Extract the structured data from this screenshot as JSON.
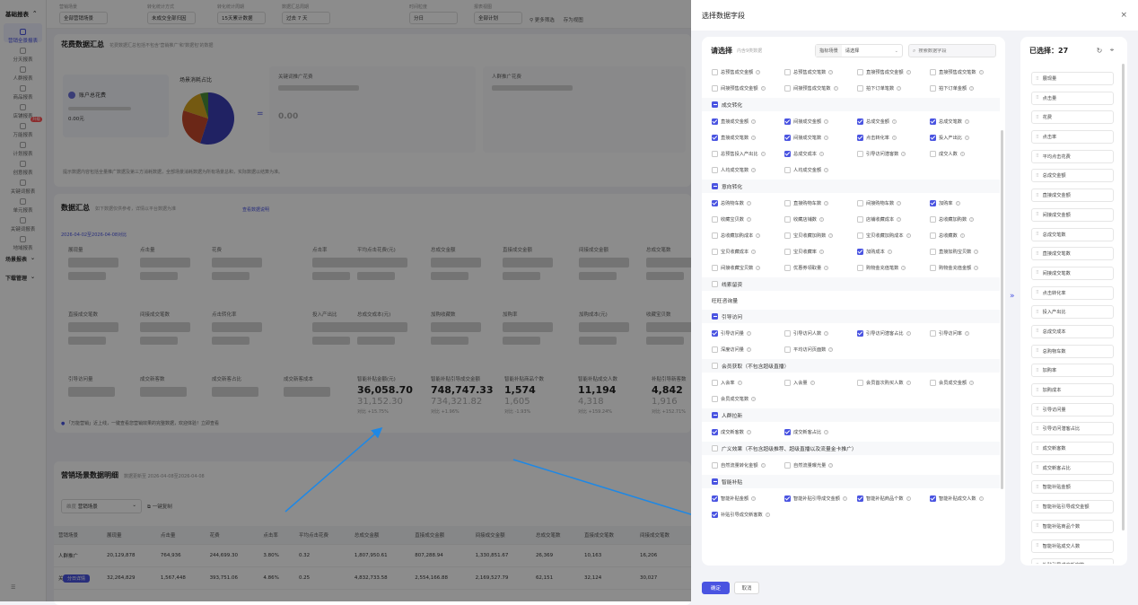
{
  "sidebar": {
    "header": "基础报表",
    "items": [
      {
        "label": "营销全景报表",
        "active": true
      },
      {
        "label": "分天报表"
      },
      {
        "label": "人群报表"
      },
      {
        "label": "商品报表"
      },
      {
        "label": "店铺报表"
      },
      {
        "label": "万能报表",
        "badge": "升级"
      },
      {
        "label": "计划报表"
      },
      {
        "label": "创意报表"
      },
      {
        "label": "关键词报表"
      },
      {
        "label": "单元报表"
      },
      {
        "label": "关键词报表"
      },
      {
        "label": "地域报表"
      }
    ],
    "groups": [
      "场景报表",
      "下载管理"
    ]
  },
  "filters": [
    {
      "label": "营销场景",
      "value": "全部营销场景"
    },
    {
      "label": "转化统计方式",
      "value": "未成交全部归因"
    },
    {
      "label": "转化统计周期",
      "value": "15天累计数据"
    },
    {
      "label": "数据汇总周期",
      "value": "过去 7 天"
    },
    {
      "label": "时间粒度",
      "value": "分日"
    },
    {
      "label": "报表视图",
      "value": "全部计划"
    }
  ],
  "filter_actions": [
    "更多筛选",
    "存为视图"
  ],
  "spend_card": {
    "title": "花费数据汇总",
    "subtitle": "花费数据汇总包括不包含'营销推广'和'数据包'的数据",
    "account_label": "账户总花费",
    "account_value": "0.00元",
    "pie_title": "场景消耗占比",
    "pie_slices": [
      {
        "value": 55,
        "color": "#3b3fb5"
      },
      {
        "value": 25,
        "color": "#c4472a"
      },
      {
        "value": 15,
        "color": "#d4a21f"
      },
      {
        "value": 5,
        "color": "#4c8f3a"
      }
    ],
    "box1_title": "关键词推广花费",
    "box2_title": "人群推广花费",
    "side_value": "0.00",
    "notice": "提示数据内容包括全量推广数据及第三方消耗数据，全部场景消耗数据为所有场景总和，实际数据以结算为准。"
  },
  "data_summary": {
    "title": "数据汇总",
    "subtitle": "如下数据仅供参考，详情以平台数据为准",
    "link": "查看数据说明",
    "date_range": "2026-04-02至2026-04-08对比",
    "row1_labels": [
      "展现量",
      "点击量",
      "花费",
      "点击率",
      "平均点击花费(元)",
      "总成交金额",
      "直接成交金额",
      "间接成交金额",
      "总成交笔数"
    ],
    "row2_labels": [
      "直接成交笔数",
      "间接成交笔数",
      "点击转化率",
      "投入产出比",
      "总成交成本(元)",
      "加购收藏数",
      "加购率",
      "加购成本(元)",
      "收藏宝贝数"
    ],
    "row3_labels": [
      "引导访问量",
      "成交新客数",
      "成交新客占比",
      "成交新客成本"
    ],
    "metrics": [
      {
        "label": "智能补贴金额(元)",
        "current": "36,058.70",
        "previous": "31,152.30",
        "change": "对比 +15.75%",
        "dir": "up"
      },
      {
        "label": "智能补贴引导成交金额",
        "current": "748,747.33",
        "previous": "734,321.82",
        "change": "对比 +1.96%",
        "dir": "up"
      },
      {
        "label": "智能补贴商品个数",
        "current": "1,574",
        "previous": "1,605",
        "change": "对比 -1.93%",
        "dir": "down"
      },
      {
        "label": "智能补贴成交人数",
        "current": "11,194",
        "previous": "4,318",
        "change": "对比 +159.24%",
        "dir": "up"
      },
      {
        "label": "补贴引导新客数",
        "current": "4,842",
        "previous": "1,916",
        "change": "对比 +152.71%",
        "dir": "up"
      }
    ],
    "tip": "「万能营销」近上线，一键查看您营销效果的完整数据，欢迎体验！立即查看"
  },
  "detail": {
    "title": "营销场景数据明细",
    "subtitle": "数据更新至 2026-04-08至2026-04-08",
    "select_label": "维度",
    "select_value": "营销场景",
    "action": "一键复制",
    "columns": [
      "营销场景",
      "展现量",
      "点击量",
      "花费",
      "点击率",
      "平均点击花费",
      "总成交金额",
      "直接成交金额",
      "间接成交金额",
      "总成交笔数",
      "直接成交笔数",
      "间接成交笔数"
    ],
    "rows": [
      [
        "人群推广",
        "20,129,878",
        "764,936",
        "244,699.30",
        "3.80%",
        "0.32",
        "1,807,950.61",
        "807,288.94",
        "1,330,851.67",
        "26,369",
        "10,163",
        "16,206"
      ],
      [
        "关键词推广",
        "32,264,829",
        "1,567,448",
        "393,751.06",
        "4.86%",
        "0.25",
        "4,832,733.58",
        "2,554,166.88",
        "2,169,527.79",
        "62,151",
        "32,124",
        "30,027"
      ]
    ],
    "tag": "分日详情"
  },
  "modal": {
    "title": "选择数据字段",
    "left_title": "请选择",
    "left_sub": "内含9类数据",
    "scope_label": "指标场景",
    "scope_value": "请选择",
    "search_placeholder": "搜索数据字段",
    "top_fields": [
      {
        "label": "总预售成交金额",
        "checked": false
      },
      {
        "label": "总预售成交笔数",
        "checked": false
      },
      {
        "label": "直接预售成交金额",
        "checked": false
      },
      {
        "label": "直接预售成交笔数",
        "checked": false
      },
      {
        "label": "间接预售成交金额",
        "checked": false
      },
      {
        "label": "间接预售成交笔数",
        "checked": false
      },
      {
        "label": "拍下订单笔数",
        "checked": false
      },
      {
        "label": "拍下订单金额",
        "checked": false
      }
    ],
    "groups": [
      {
        "name": "成交转化",
        "state": "part",
        "fields": [
          {
            "label": "直接成交金额",
            "checked": true
          },
          {
            "label": "间接成交金额",
            "checked": true
          },
          {
            "label": "总成交金额",
            "checked": true
          },
          {
            "label": "总成交笔数",
            "checked": true
          },
          {
            "label": "直接成交笔数",
            "checked": true
          },
          {
            "label": "间接成交笔数",
            "checked": true
          },
          {
            "label": "点击转化率",
            "checked": true
          },
          {
            "label": "投入产出比",
            "checked": true
          },
          {
            "label": "总预售投入产出比",
            "checked": false
          },
          {
            "label": "总成交成本",
            "checked": true
          },
          {
            "label": "引导访问潜客数",
            "checked": false
          },
          {
            "label": "成交人数",
            "checked": false
          },
          {
            "label": "人均成交笔数",
            "checked": false
          },
          {
            "label": "人均成交金额",
            "checked": false
          }
        ]
      },
      {
        "name": "意向转化",
        "state": "part",
        "fields": [
          {
            "label": "总购物车数",
            "checked": true
          },
          {
            "label": "直接购物车数",
            "checked": false
          },
          {
            "label": "间接购物车数",
            "checked": false
          },
          {
            "label": "加购率",
            "checked": true
          },
          {
            "label": "收藏宝贝数",
            "checked": false
          },
          {
            "label": "收藏店铺数",
            "checked": false
          },
          {
            "label": "店铺收藏成本",
            "checked": false
          },
          {
            "label": "总收藏加购数",
            "checked": false
          },
          {
            "label": "总收藏加购成本",
            "checked": false
          },
          {
            "label": "宝贝收藏加购数",
            "checked": false
          },
          {
            "label": "宝贝收藏加购成本",
            "checked": false
          },
          {
            "label": "总收藏数",
            "checked": false
          },
          {
            "label": "宝贝收藏成本",
            "checked": false
          },
          {
            "label": "宝贝收藏率",
            "checked": false
          },
          {
            "label": "加购成本",
            "checked": true
          },
          {
            "label": "直接加购宝贝数",
            "checked": false
          },
          {
            "label": "间接收藏宝贝数",
            "checked": false
          },
          {
            "label": "优惠券领取量",
            "checked": false
          },
          {
            "label": "购物金充值笔数",
            "checked": false
          },
          {
            "label": "购物金充值金额",
            "checked": false
          }
        ]
      },
      {
        "name": "线索留资",
        "state": "none",
        "fields": []
      },
      {
        "name": "旺旺咨询量",
        "state": "none",
        "plain": true,
        "fields": []
      },
      {
        "name": "引导访问",
        "state": "part",
        "fields": [
          {
            "label": "引导访问量",
            "checked": true
          },
          {
            "label": "引导访问人数",
            "checked": false
          },
          {
            "label": "引导访问潜客占比",
            "checked": true
          },
          {
            "label": "引导访问率",
            "checked": false
          },
          {
            "label": "深度访问量",
            "checked": false
          },
          {
            "label": "平均访问页面数",
            "checked": false
          }
        ]
      },
      {
        "name": "会员获取（不包含超级直播）",
        "state": "none",
        "fields": [
          {
            "label": "入会率",
            "checked": false
          },
          {
            "label": "入会量",
            "checked": false
          },
          {
            "label": "会员首次购买人数",
            "checked": false
          },
          {
            "label": "会员成交金额",
            "checked": false
          },
          {
            "label": "会员成交笔数",
            "checked": false
          }
        ]
      },
      {
        "name": "人群拉新",
        "state": "part",
        "fields": [
          {
            "label": "成交新客数",
            "checked": true
          },
          {
            "label": "成交新客占比",
            "checked": true
          }
        ]
      },
      {
        "name": "广义效果（不包含超级推荐、超级直播以及流量金卡推广）",
        "state": "none",
        "fields": [
          {
            "label": "自然流量转化金额",
            "checked": false
          },
          {
            "label": "自然流量曝光量",
            "checked": false
          }
        ]
      },
      {
        "name": "智能补贴",
        "state": "part",
        "fields": [
          {
            "label": "智能补贴金额",
            "checked": true
          },
          {
            "label": "智能补贴引导成交金额",
            "checked": true
          },
          {
            "label": "智能补贴商品个数",
            "checked": true
          },
          {
            "label": "智能补贴成交人数",
            "checked": true
          },
          {
            "label": "补贴引导成交新客数",
            "checked": true
          }
        ]
      }
    ],
    "right_title": "已选择：27",
    "selected": [
      "展现量",
      "点击量",
      "花费",
      "点击率",
      "平均点击花费",
      "总成交金额",
      "直接成交金额",
      "间接成交金额",
      "总成交笔数",
      "直接成交笔数",
      "间接成交笔数",
      "点击转化率",
      "投入产出比",
      "总成交成本",
      "总购物车数",
      "加购率",
      "加购成本",
      "引导访问量",
      "引导访问潜客占比",
      "成交新客数",
      "成交新客占比",
      "智能补贴金额",
      "智能补贴引导成交金额",
      "智能补贴商品个数",
      "智能补贴成交人数",
      "补贴引导成交新客数",
      "智能补贴商品个数"
    ],
    "confirm": "确定",
    "cancel": "取消"
  },
  "colors": {
    "accent": "#4a54e1",
    "arrow": "#1e88e5"
  }
}
